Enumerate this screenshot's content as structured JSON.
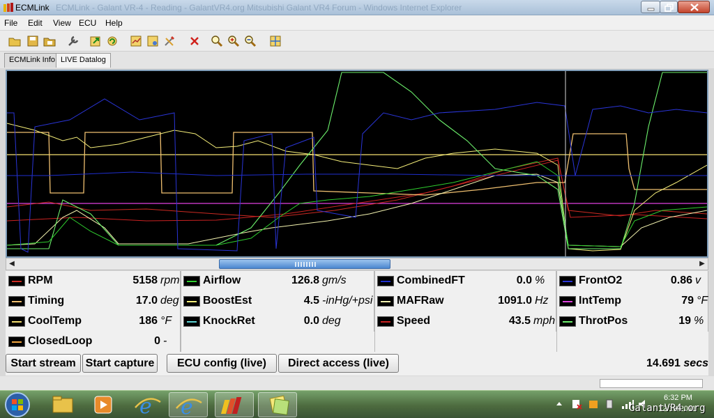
{
  "window": {
    "title": "ECMLink",
    "title_extra": "ECMLink - Galant VR-4 - Reading - GalantVR4.org Mitsubishi Galant VR4 Forum - Windows Internet Explorer"
  },
  "menu": [
    "File",
    "Edit",
    "View",
    "ECU",
    "Help"
  ],
  "toolbar_icons": [
    "open-folder-icon",
    "save-icon",
    "open-log-icon",
    "wrench-icon",
    "export-icon",
    "refresh-icon",
    "map-icon",
    "map-settings-icon",
    "tools-icon",
    "delete-icon",
    "zoom-fit-icon",
    "zoom-in-icon",
    "zoom-out-icon",
    "grid-icon"
  ],
  "tabs": [
    "ECMLink Info",
    "LIVE Datalog"
  ],
  "colors": {
    "rpm": "#cc2a22",
    "airflow": "#2fcf2f",
    "combinedft": "#1f2fcf",
    "fronto2": "#2a35d8",
    "timing": "#f0c070",
    "boostest": "#f7f07a",
    "mafraw": "#f4f4b0",
    "inttemp": "#e040e0",
    "cooltemp": "#f5e070",
    "knockret": "#5fd6d6",
    "speed": "#cc2222",
    "throtpos": "#6cf06c",
    "closedloop": "#f5a840"
  },
  "gauges": [
    {
      "name": "RPM",
      "value": "5158",
      "unit": "rpm"
    },
    {
      "name": "Airflow",
      "value": "126.8",
      "unit": "gm/s"
    },
    {
      "name": "CombinedFT",
      "value": "0.0",
      "unit": "%"
    },
    {
      "name": "FrontO2",
      "value": "0.86",
      "unit": "v"
    },
    {
      "name": "Timing",
      "value": "17.0",
      "unit": "deg"
    },
    {
      "name": "BoostEst",
      "value": "4.5",
      "unit": "-inHg/+psi"
    },
    {
      "name": "MAFRaw",
      "value": "1091.0",
      "unit": "Hz"
    },
    {
      "name": "IntTemp",
      "value": "79",
      "unit": "°F"
    },
    {
      "name": "CoolTemp",
      "value": "186",
      "unit": "°F"
    },
    {
      "name": "KnockRet",
      "value": "0.0",
      "unit": "deg"
    },
    {
      "name": "Speed",
      "value": "43.5",
      "unit": "mph"
    },
    {
      "name": "ThrotPos",
      "value": "19",
      "unit": "%"
    },
    {
      "name": "ClosedLoop",
      "value": "0",
      "unit": "-"
    }
  ],
  "buttons": {
    "start_stream": "Start stream",
    "start_capture": "Start capture",
    "ecu_config": "ECU config (live)",
    "direct_access": "Direct access (live)"
  },
  "elapsed": {
    "value": "14.691",
    "unit": "secs"
  },
  "taskbar": {
    "time": "6:32 PM",
    "date": "12/13/2011",
    "watermark": "GalantVR4.org"
  }
}
